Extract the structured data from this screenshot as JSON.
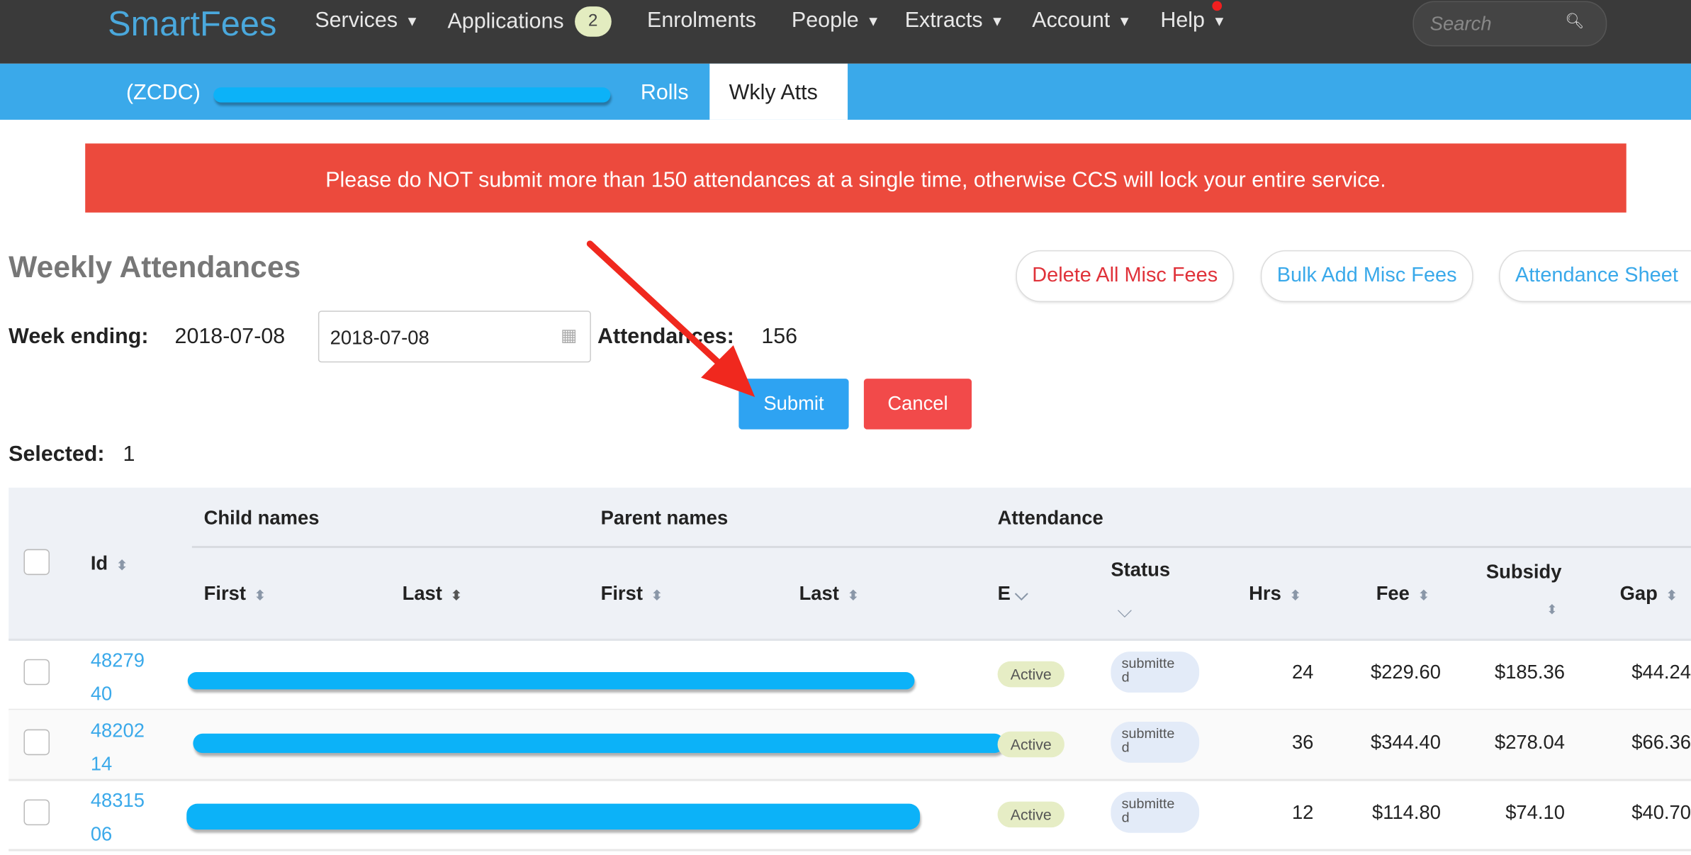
{
  "nav": {
    "logo": "SmartFees",
    "items": [
      {
        "label": "Services",
        "caret": true
      },
      {
        "label": "Applications",
        "badge": "2"
      },
      {
        "label": "Enrolments"
      },
      {
        "label": "People",
        "caret": true
      },
      {
        "label": "Extracts",
        "caret": true
      },
      {
        "label": "Account",
        "caret": true
      },
      {
        "label": "Help",
        "caret": true
      }
    ],
    "search_placeholder": "Search"
  },
  "subnav": {
    "service": "(ZCDC)",
    "tabs": [
      "Rolls",
      "Wkly Atts"
    ],
    "active_tab": "Wkly Atts"
  },
  "alert": "Please do NOT submit more than 150 attendances at a single time, otherwise CCS will lock your entire service.",
  "page": {
    "title": "Weekly Attendances",
    "actions": [
      "Delete All Misc Fees",
      "Bulk Add Misc Fees",
      "Attendance Sheet"
    ],
    "week_ending_label": "Week ending:",
    "week_ending_value": "2018-07-08",
    "date_input": "2018-07-08",
    "attendances_label": "Attendances:",
    "attendances_value": "156",
    "submit": "Submit",
    "cancel": "Cancel",
    "selected_label": "Selected:",
    "selected_value": "1"
  },
  "table": {
    "groups": [
      "Child names",
      "Parent names",
      "Attendance"
    ],
    "columns": [
      "Id",
      "First",
      "Last",
      "First",
      "Last",
      "E",
      "Status",
      "Hrs",
      "Fee",
      "Subsidy",
      "Gap"
    ],
    "rows": [
      {
        "id": "4827940",
        "id_l1": "48279",
        "id_l2": "40",
        "enrol": "Active",
        "status": "submitted",
        "status_l1": "submitte",
        "status_l2": "d",
        "hrs": "24",
        "fee": "$229.60",
        "subsidy": "$185.36",
        "gap": "$44.24"
      },
      {
        "id": "4820214",
        "id_l1": "48202",
        "id_l2": "14",
        "enrol": "Active",
        "status": "submitted",
        "status_l1": "submitte",
        "status_l2": "d",
        "hrs": "36",
        "fee": "$344.40",
        "subsidy": "$278.04",
        "gap": "$66.36"
      },
      {
        "id": "4831506",
        "id_l1": "48315",
        "id_l2": "06",
        "enrol": "Active",
        "status": "submitted",
        "status_l1": "submitte",
        "status_l2": "d",
        "hrs": "12",
        "fee": "$114.80",
        "subsidy": "$74.10",
        "gap": "$40.70"
      }
    ]
  },
  "colors": {
    "topbar": "#3a3a3a",
    "subbar": "#3aa9ea",
    "alert": "#ec4a3d",
    "submit": "#2ea3f2",
    "cancel": "#f24a4a",
    "redaction": "#0cb2f8",
    "annotation_arrow": "#f0281e"
  }
}
